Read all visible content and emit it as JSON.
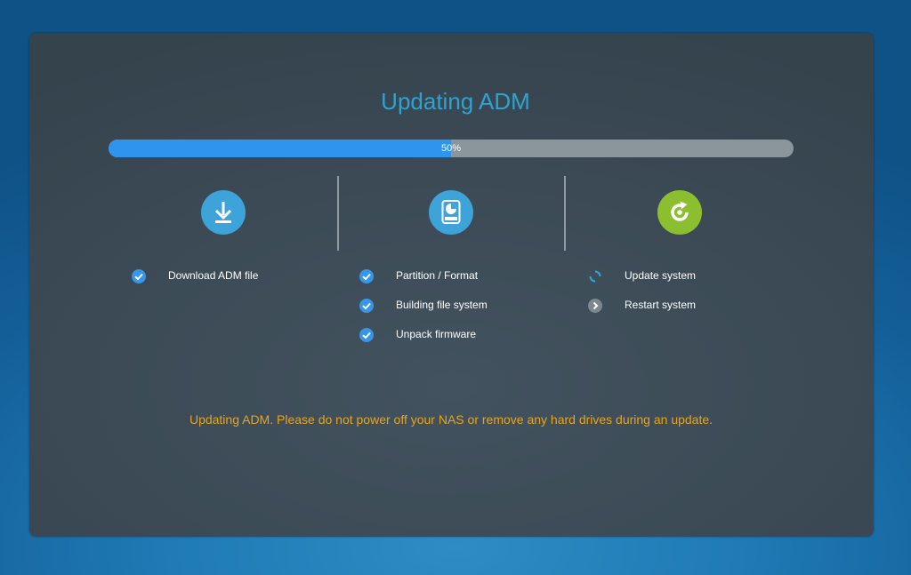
{
  "title": "Updating ADM",
  "progress": {
    "percent": 50,
    "label": "50%"
  },
  "stages": [
    {
      "icon": "download-icon",
      "icon_color": "#3da3d8",
      "steps": [
        {
          "label": "Download ADM file",
          "status": "done"
        }
      ]
    },
    {
      "icon": "hard-drive-icon",
      "icon_color": "#3da3d8",
      "steps": [
        {
          "label": "Partition / Format",
          "status": "done"
        },
        {
          "label": "Building file system",
          "status": "done"
        },
        {
          "label": "Unpack firmware",
          "status": "done"
        }
      ]
    },
    {
      "icon": "refresh-icon",
      "icon_color": "#8bbf2f",
      "steps": [
        {
          "label": "Update system",
          "status": "in-progress"
        },
        {
          "label": "Restart system",
          "status": "pending"
        }
      ]
    }
  ],
  "warning": "Updating ADM. Please do not power off your NAS or remove any hard drives during an update.",
  "colors": {
    "title": "#2fa3cf",
    "progress_fill": "#2d95ee",
    "progress_track": "#8a959c",
    "done_check": "#3796e8",
    "spinner": "#29a8e6",
    "pending": "#7d878e",
    "warning": "#e7a41e"
  }
}
